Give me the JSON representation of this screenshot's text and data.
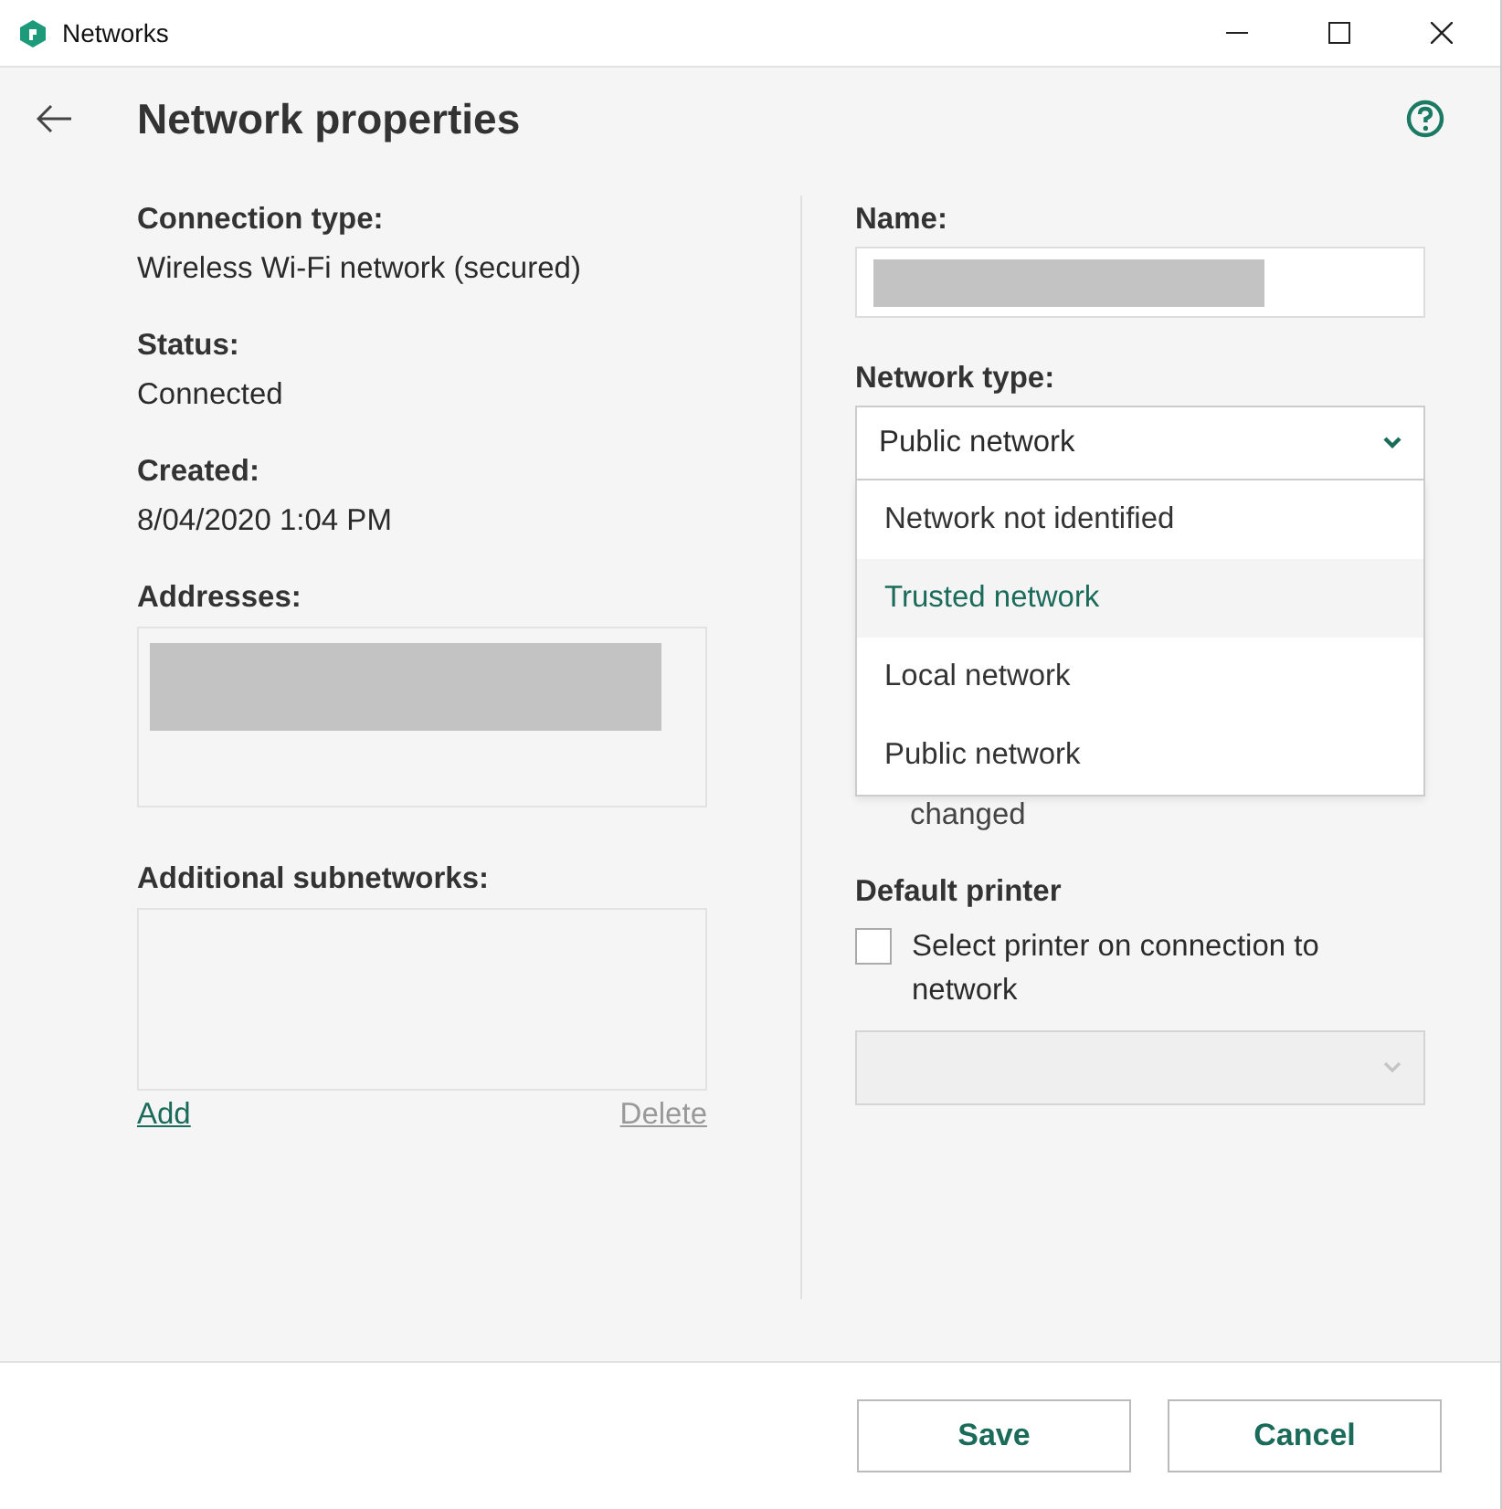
{
  "window": {
    "title": "Networks"
  },
  "header": {
    "title": "Network properties"
  },
  "details": [
    {
      "label": "Connection type:",
      "value": "Wireless Wi-Fi network (secured)"
    },
    {
      "label": "Status:",
      "value": "Connected"
    },
    {
      "label": "Created:",
      "value": "8/04/2020 1:04 PM"
    }
  ],
  "addresses": {
    "label": "Addresses:"
  },
  "subnetworks": {
    "label": "Additional subnetworks:",
    "links": [
      {
        "label": "Add",
        "disabled": false
      },
      {
        "label": "Delete",
        "disabled": true
      }
    ]
  },
  "name_field": {
    "label": "Name:"
  },
  "network_type": {
    "label": "Network type:",
    "value": "Public network",
    "expanded": true,
    "options": [
      {
        "label": "Network not identified",
        "highlighted": false
      },
      {
        "label": "Trusted network",
        "highlighted": true
      },
      {
        "label": "Local network",
        "highlighted": false
      },
      {
        "label": "Public network",
        "highlighted": false
      }
    ]
  },
  "partially_hidden_text": "changed",
  "default_printer": {
    "heading": "Default printer",
    "checkbox": {
      "label": "Select printer on connection to network",
      "checked": false
    },
    "printer_select": {
      "disabled": true
    }
  },
  "buttons": [
    {
      "label": "Save"
    },
    {
      "label": "Cancel"
    }
  ]
}
